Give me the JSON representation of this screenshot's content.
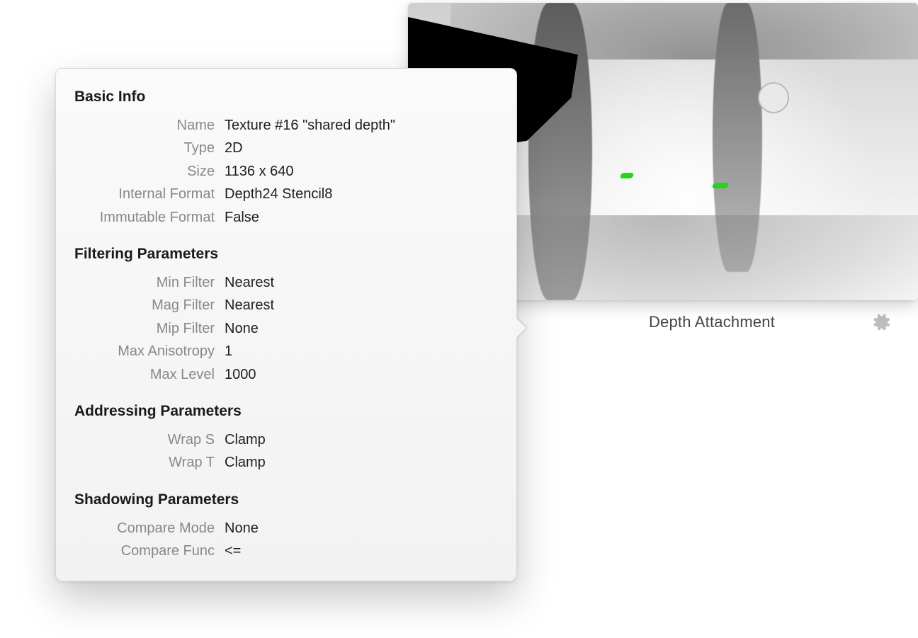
{
  "thumbnail": {
    "caption": "Depth Attachment",
    "info_icon": "info-icon",
    "settings_icon": "gear-icon"
  },
  "popover": {
    "sections": {
      "basic_info": {
        "title": "Basic Info",
        "rows": {
          "name": {
            "label": "Name",
            "value": "Texture #16 \"shared depth\""
          },
          "type": {
            "label": "Type",
            "value": "2D"
          },
          "size": {
            "label": "Size",
            "value": "1136 x 640"
          },
          "internal_format": {
            "label": "Internal Format",
            "value": "Depth24 Stencil8"
          },
          "immutable_format": {
            "label": "Immutable Format",
            "value": "False"
          }
        }
      },
      "filtering": {
        "title": "Filtering Parameters",
        "rows": {
          "min_filter": {
            "label": "Min Filter",
            "value": "Nearest"
          },
          "mag_filter": {
            "label": "Mag Filter",
            "value": "Nearest"
          },
          "mip_filter": {
            "label": "Mip Filter",
            "value": "None"
          },
          "max_anisotropy": {
            "label": "Max Anisotropy",
            "value": "1"
          },
          "max_level": {
            "label": "Max Level",
            "value": "1000"
          }
        }
      },
      "addressing": {
        "title": "Addressing Parameters",
        "rows": {
          "wrap_s": {
            "label": "Wrap S",
            "value": "Clamp"
          },
          "wrap_t": {
            "label": "Wrap T",
            "value": "Clamp"
          }
        }
      },
      "shadowing": {
        "title": "Shadowing Parameters",
        "rows": {
          "compare_mode": {
            "label": "Compare Mode",
            "value": "None"
          },
          "compare_func": {
            "label": "Compare Func",
            "value": "<="
          }
        }
      }
    }
  }
}
